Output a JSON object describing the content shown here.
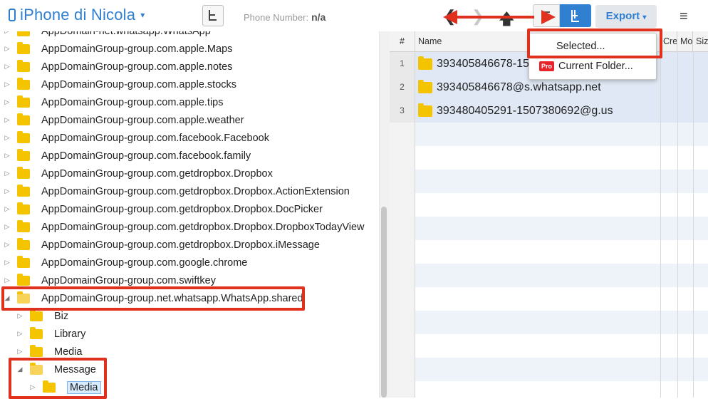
{
  "device": {
    "name": "iPhone di Nicola"
  },
  "phone": {
    "label": "Phone Number:",
    "value": "n/a"
  },
  "toolbar": {
    "export_label": "Export"
  },
  "export_menu": {
    "selected": "Selected...",
    "pro_badge": "Pro",
    "current_folder": "Current Folder..."
  },
  "tree": {
    "items": [
      {
        "label": "AppDomain-net.whatsapp.WhatsApp",
        "indent": 0,
        "open": false
      },
      {
        "label": "AppDomainGroup-group.com.apple.Maps",
        "indent": 0,
        "open": false
      },
      {
        "label": "AppDomainGroup-group.com.apple.notes",
        "indent": 0,
        "open": false
      },
      {
        "label": "AppDomainGroup-group.com.apple.stocks",
        "indent": 0,
        "open": false
      },
      {
        "label": "AppDomainGroup-group.com.apple.tips",
        "indent": 0,
        "open": false
      },
      {
        "label": "AppDomainGroup-group.com.apple.weather",
        "indent": 0,
        "open": false
      },
      {
        "label": "AppDomainGroup-group.com.facebook.Facebook",
        "indent": 0,
        "open": false
      },
      {
        "label": "AppDomainGroup-group.com.facebook.family",
        "indent": 0,
        "open": false
      },
      {
        "label": "AppDomainGroup-group.com.getdropbox.Dropbox",
        "indent": 0,
        "open": false
      },
      {
        "label": "AppDomainGroup-group.com.getdropbox.Dropbox.ActionExtension",
        "indent": 0,
        "open": false
      },
      {
        "label": "AppDomainGroup-group.com.getdropbox.Dropbox.DocPicker",
        "indent": 0,
        "open": false
      },
      {
        "label": "AppDomainGroup-group.com.getdropbox.Dropbox.DropboxTodayView",
        "indent": 0,
        "open": false
      },
      {
        "label": "AppDomainGroup-group.com.getdropbox.Dropbox.iMessage",
        "indent": 0,
        "open": false
      },
      {
        "label": "AppDomainGroup-group.com.google.chrome",
        "indent": 0,
        "open": false
      },
      {
        "label": "AppDomainGroup-group.com.swiftkey",
        "indent": 0,
        "open": false
      },
      {
        "label": "AppDomainGroup-group.net.whatsapp.WhatsApp.shared",
        "indent": 0,
        "open": true
      },
      {
        "label": "Biz",
        "indent": 1,
        "open": false
      },
      {
        "label": "Library",
        "indent": 1,
        "open": false
      },
      {
        "label": "Media",
        "indent": 1,
        "open": false
      },
      {
        "label": "Message",
        "indent": 1,
        "open": true
      },
      {
        "label": "Media",
        "indent": 2,
        "open": false,
        "selected": true
      }
    ]
  },
  "grid": {
    "columns": {
      "num": "#",
      "name": "Name",
      "created": "Cre",
      "modified": "Mo",
      "size": "Siz"
    },
    "rows": [
      {
        "num": "1",
        "name": "393405846678-15"
      },
      {
        "num": "2",
        "name": "393405846678@s.whatsapp.net"
      },
      {
        "num": "3",
        "name": "393480405291-1507380692@g.us"
      }
    ]
  },
  "colors": {
    "accent": "#2f7fd1",
    "highlight": "#e0311e"
  }
}
